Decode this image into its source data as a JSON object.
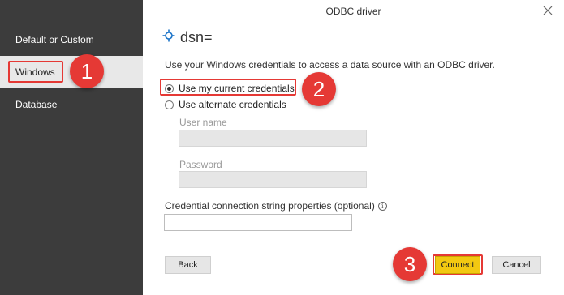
{
  "window": {
    "title": "ODBC driver"
  },
  "sidebar": {
    "items": [
      {
        "label": "Default or Custom"
      },
      {
        "label": "Windows"
      },
      {
        "label": "Database"
      }
    ]
  },
  "main": {
    "dsn_title": "dsn=",
    "description": "Use your Windows credentials to access a data source with an ODBC driver.",
    "radio_current": "Use my current credentials",
    "radio_alternate": "Use alternate credentials",
    "username_label": "User name",
    "password_label": "Password",
    "conn_string_label": "Credential connection string properties (optional)",
    "info_glyph": "i"
  },
  "buttons": {
    "back": "Back",
    "connect": "Connect",
    "cancel": "Cancel"
  },
  "callouts": [
    "1",
    "2",
    "3"
  ],
  "colors": {
    "sidebar_bg": "#3c3c3c",
    "callout": "#e53935",
    "primary_button": "#f2c811"
  }
}
